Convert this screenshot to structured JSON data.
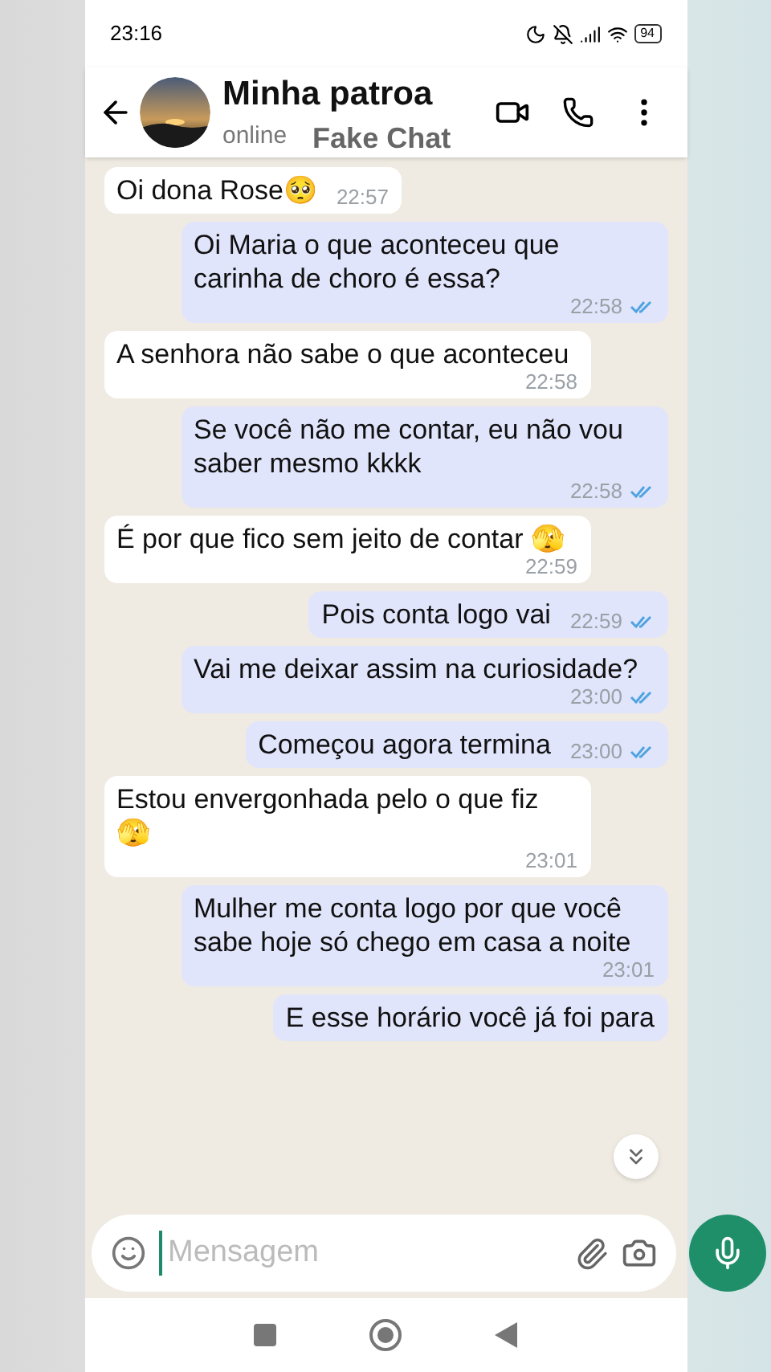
{
  "status_bar": {
    "time": "23:16",
    "battery": "94"
  },
  "header": {
    "contact_name": "Minha patroa",
    "presence": "online",
    "overlay_label": "Fake Chat"
  },
  "messages": [
    {
      "kind": "incoming",
      "text": "Oi dona Rose🥺",
      "time": "22:57"
    },
    {
      "kind": "outgoing",
      "text": "Oi Maria o que aconteceu que carinha de choro é essa?",
      "time": "22:58",
      "read": true
    },
    {
      "kind": "incoming",
      "text": "A senhora não sabe o que aconteceu",
      "time": "22:58"
    },
    {
      "kind": "outgoing",
      "text": "Se você não me contar, eu não vou saber mesmo kkkk",
      "time": "22:58",
      "read": true
    },
    {
      "kind": "incoming",
      "text": "É por que fico sem jeito de contar 🫣",
      "time": "22:59"
    },
    {
      "kind": "outgoing",
      "text": "Pois conta logo vai",
      "time": "22:59",
      "read": true
    },
    {
      "kind": "outgoing",
      "text": "Vai me deixar assim na curiosidade?",
      "time": "23:00",
      "read": true
    },
    {
      "kind": "outgoing",
      "text": "Começou agora termina",
      "time": "23:00",
      "read": true
    },
    {
      "kind": "incoming",
      "text": "Estou envergonhada pelo o que fiz 🫣",
      "time": "23:01"
    },
    {
      "kind": "outgoing",
      "text": "Mulher me conta logo por que você sabe hoje só chego em casa a noite",
      "time": "23:01"
    },
    {
      "kind": "outgoing",
      "text": "E esse horário você já foi para"
    }
  ],
  "composer": {
    "placeholder": "Mensagem"
  }
}
